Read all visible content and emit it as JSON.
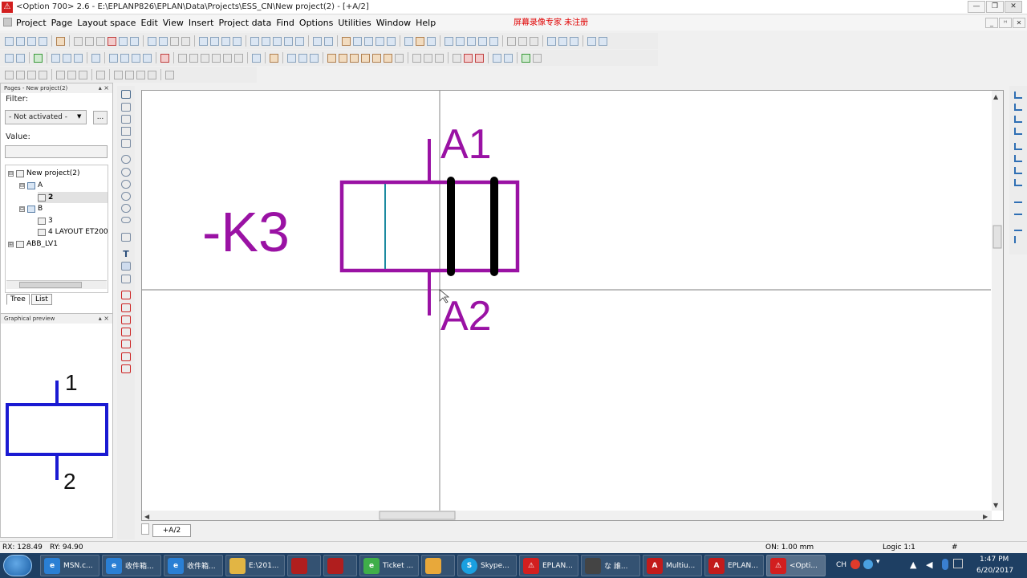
{
  "window": {
    "title": "<Option 700> 2.6 - E:\\EPLANP826\\EPLAN\\Data\\Projects\\ESS_CN\\New project(2) - [+A/2]",
    "app_icon": "eplan-logo-icon",
    "watermark": "屏幕录像专家  未注册",
    "controls": {
      "minimize": "—",
      "restore": "❐",
      "close": "✕"
    },
    "mdi_controls": {
      "minimize": "_",
      "restore": "ᴴ",
      "close": "✕"
    }
  },
  "menu": {
    "items": [
      "Project",
      "Page",
      "Layout space",
      "Edit",
      "View",
      "Insert",
      "Project data",
      "Find",
      "Options",
      "Utilities",
      "Window",
      "Help"
    ]
  },
  "pages_panel": {
    "title": "Pages - New project(2)",
    "close_label": "▴ ×",
    "filter_label": "Filter:",
    "filter_value": "- Not activated -",
    "filter_more": "...",
    "value_label": "Value:",
    "value_input": "",
    "tree": [
      {
        "label": "New project(2)",
        "toggle": "⊟",
        "icon": "project"
      },
      {
        "label": "A",
        "toggle": "⊟",
        "icon": "structure"
      },
      {
        "label": "2",
        "toggle": "",
        "icon": "page",
        "selected": true
      },
      {
        "label": "B",
        "toggle": "⊟",
        "icon": "structure"
      },
      {
        "label": "3",
        "toggle": "",
        "icon": "page"
      },
      {
        "label": "4 LAYOUT ET200",
        "toggle": "",
        "icon": "page"
      },
      {
        "label": "ABB_LV1",
        "toggle": "⊞",
        "icon": "project"
      }
    ],
    "tabs": [
      "Tree",
      "List"
    ],
    "active_tab": "Tree"
  },
  "preview_panel": {
    "title": "Graphical preview",
    "close_label": "▴ ×",
    "pin_top": "1",
    "pin_bottom": "2",
    "symbol_color": "#1a1ad2"
  },
  "drawing": {
    "device_tag": "-K3",
    "pin_top": "A1",
    "pin_bottom": "A2",
    "symbol_color": "#9a12a4",
    "inner_line_color": "#1c8aa0"
  },
  "page_tab": "+A/2",
  "status": {
    "rx": "RX: 128.49",
    "ry": "RY: 94.90",
    "on": "ON: 1.00 mm",
    "logic": "Logic 1:1",
    "hash": "#"
  },
  "taskbar": {
    "items": [
      {
        "label": "MSN.c...",
        "icon": "ie-icon",
        "color": "#2a7fd4"
      },
      {
        "label": "收件箱...",
        "icon": "ie-icon",
        "color": "#2a7fd4"
      },
      {
        "label": "收件箱...",
        "icon": "ie-icon",
        "color": "#2a7fd4"
      },
      {
        "label": "E:\\201...",
        "icon": "folder-icon",
        "color": "#e2b544"
      },
      {
        "label": "",
        "icon": "app-icon",
        "color": "#b01e1e"
      },
      {
        "label": "",
        "icon": "app-icon",
        "color": "#b01e1e"
      },
      {
        "label": "Ticket ...",
        "icon": "ie-icon",
        "color": "#3fae49"
      },
      {
        "label": "",
        "icon": "outlook-icon",
        "color": "#e8a83a"
      },
      {
        "label": "Skype...",
        "icon": "skype-icon",
        "color": "#1aa0e0"
      },
      {
        "label": "EPLAN...",
        "icon": "eplan-icon",
        "color": "#d21f1f"
      },
      {
        "label": "な 誰...",
        "icon": "game-icon",
        "color": "#444444"
      },
      {
        "label": "Multiu...",
        "icon": "pdf-icon",
        "color": "#c21b1b"
      },
      {
        "label": "EPLAN...",
        "icon": "pdf-icon",
        "color": "#c21b1b"
      },
      {
        "label": "<Opti...",
        "icon": "eplan-icon",
        "color": "#d21f1f"
      }
    ],
    "tray": {
      "lang": "CH",
      "time": "1:47 PM",
      "date": "6/20/2017"
    }
  }
}
